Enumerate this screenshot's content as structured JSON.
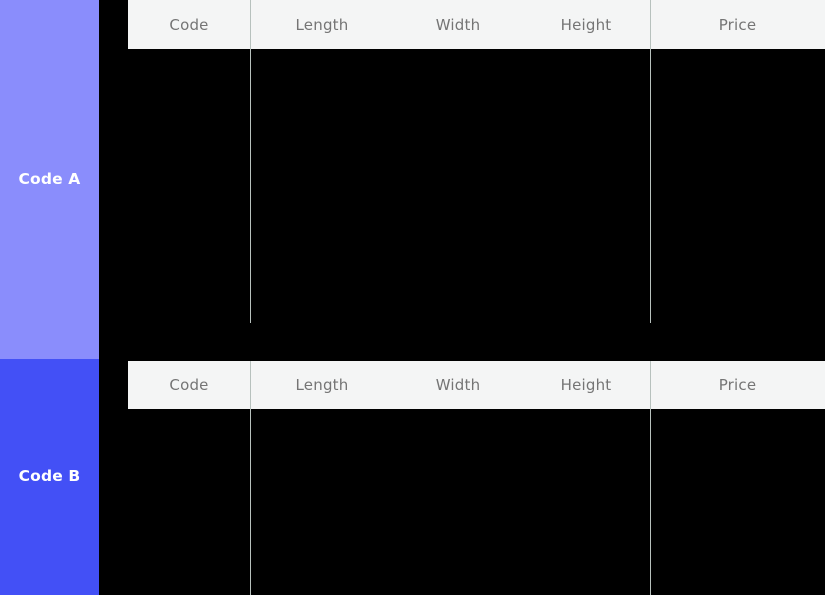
{
  "colors": {
    "background": "#000000",
    "header_bg": "#f4f5f5",
    "header_text": "#757575",
    "divider": "#b7c1bd",
    "rail_label_text": "#ffffff",
    "code_a_bg": "#8a8dfc",
    "code_b_bg": "#4350f6"
  },
  "rail": {
    "groups": [
      {
        "label": "Code A",
        "color": "#8a8dfc"
      },
      {
        "label": "Code B",
        "color": "#4350f6"
      }
    ]
  },
  "tables": [
    {
      "group_label": "Code A",
      "columns": [
        "Code",
        "Length",
        "Width",
        "Height",
        "Price"
      ],
      "rows": []
    },
    {
      "group_label": "Code B",
      "columns": [
        "Code",
        "Length",
        "Width",
        "Height",
        "Price"
      ],
      "rows": []
    }
  ]
}
